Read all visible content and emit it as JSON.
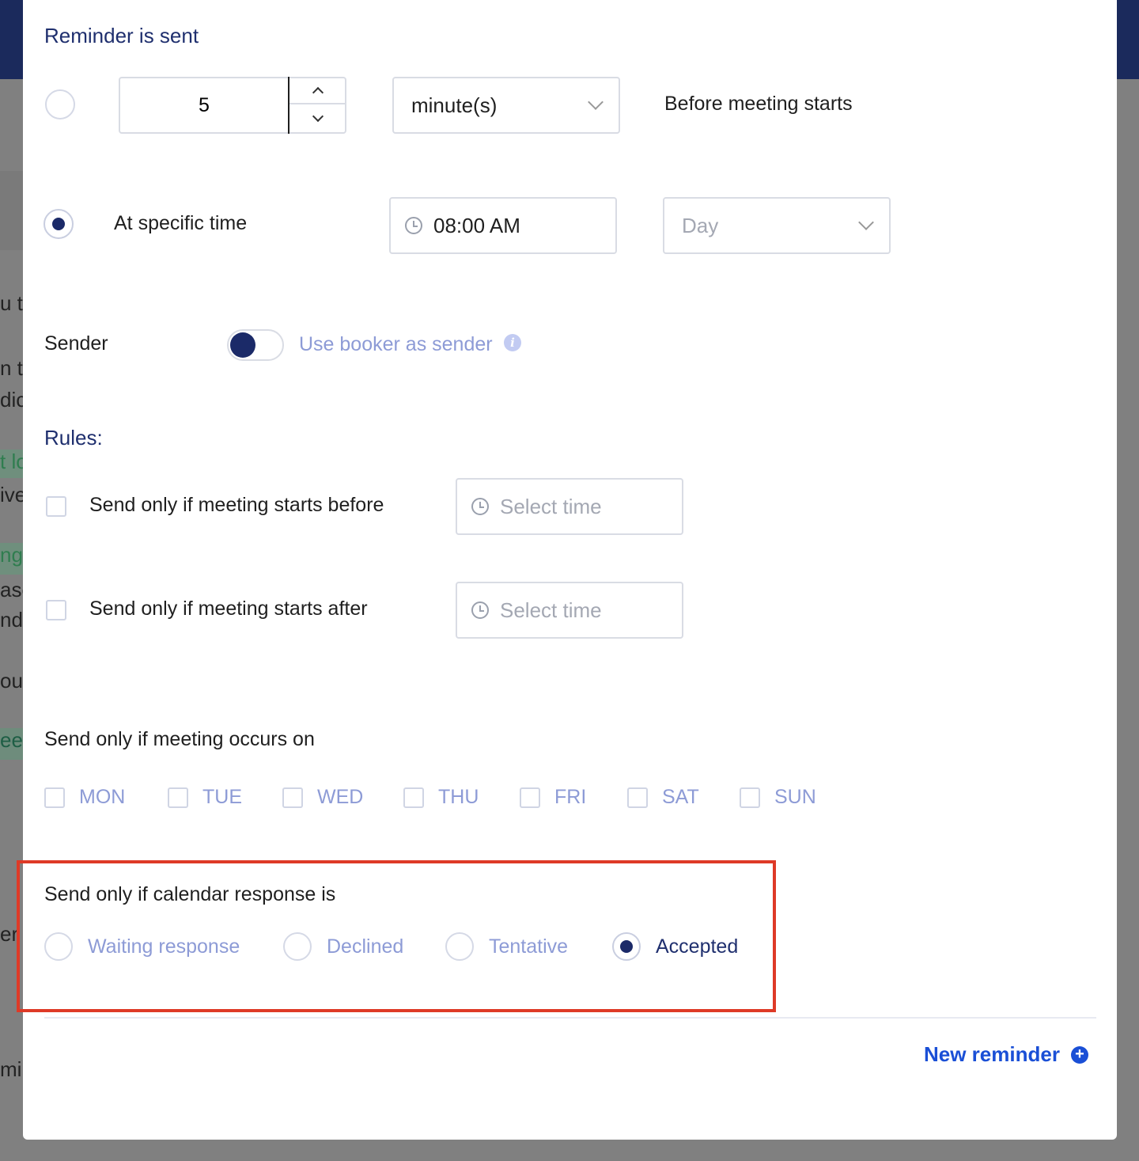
{
  "background": {
    "fragments": [
      "u t",
      "n th",
      "dic",
      "t lo",
      "ive",
      "ng",
      "ase",
      "nd y",
      "ou",
      "eet",
      "er",
      "mir"
    ]
  },
  "modal": {
    "reminder_heading": "Reminder is sent",
    "relative": {
      "amount": "5",
      "unit": "minute(s)",
      "suffix": "Before meeting starts"
    },
    "specific": {
      "label": "At specific time",
      "time": "08:00 AM",
      "day_placeholder": "Day"
    },
    "sender": {
      "label": "Sender",
      "toggle_label": "Use booker as sender",
      "info_glyph": "i"
    },
    "rules": {
      "heading": "Rules:",
      "before_label": "Send only if meeting starts before",
      "after_label": "Send only if meeting starts after",
      "time_placeholder": "Select time"
    },
    "days": {
      "label": "Send only if meeting occurs on",
      "items": [
        "MON",
        "TUE",
        "WED",
        "THU",
        "FRI",
        "SAT",
        "SUN"
      ]
    },
    "response": {
      "label": "Send only if calendar response is",
      "options": [
        "Waiting response",
        "Declined",
        "Tentative",
        "Accepted"
      ],
      "selected": "Accepted"
    },
    "new_reminder": "New reminder"
  },
  "colors": {
    "primary": "#1b2a68",
    "link": "#1a4fd6",
    "highlight": "#de3a27",
    "muted_text": "#8d9bd6"
  }
}
